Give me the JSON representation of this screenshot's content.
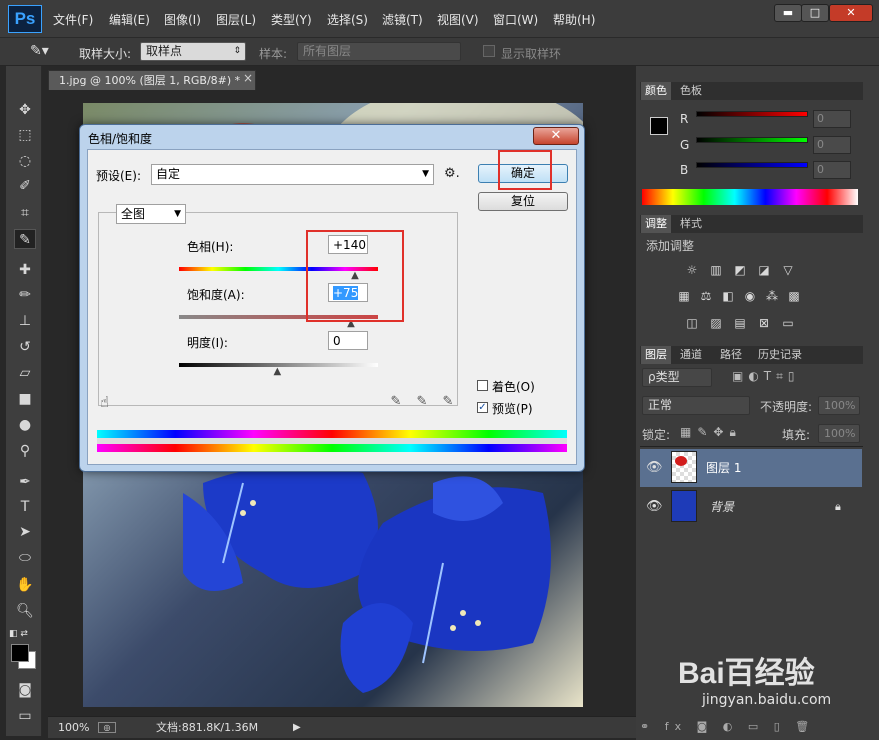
{
  "app": {
    "logo": "Ps"
  },
  "menu": [
    "文件(F)",
    "编辑(E)",
    "图像(I)",
    "图层(L)",
    "类型(Y)",
    "选择(S)",
    "滤镜(T)",
    "视图(V)",
    "窗口(W)",
    "帮助(H)"
  ],
  "window_controls": {
    "minimize": "▬",
    "maximize": "□",
    "close": "✕"
  },
  "options": {
    "sample_size_label": "取样大小:",
    "sample_size_value": "取样点",
    "sample_label": "样本:",
    "sample_value": "所有图层",
    "show_ring": "显示取样环"
  },
  "document": {
    "tab_title": "1.jpg @ 100% (图层 1, RGB/8#) *",
    "tab_close": "×",
    "zoom": "100%",
    "doc_info": "文档:881.8K/1.36M"
  },
  "color_panel": {
    "tabs": [
      "颜色",
      "色板"
    ],
    "channels": [
      {
        "label": "R",
        "value": "0",
        "color": "#ff0000"
      },
      {
        "label": "G",
        "value": "0",
        "color": "#00ff00"
      },
      {
        "label": "B",
        "value": "0",
        "color": "#0000ff"
      }
    ]
  },
  "adjust_panel": {
    "tabs": [
      "调整",
      "样式"
    ],
    "header": "添加调整"
  },
  "layers_panel": {
    "tabs": [
      "图层",
      "通道",
      "路径",
      "历史记录"
    ],
    "filter": "ρ类型",
    "blend_mode": "正常",
    "opacity_label": "不透明度:",
    "opacity_value": "100%",
    "lock_label": "锁定:",
    "fill_label": "填充:",
    "fill_value": "100%",
    "layers": [
      {
        "name": "图层 1",
        "selected": true
      },
      {
        "name": "背景",
        "italic": true,
        "locked": true
      }
    ]
  },
  "dialog": {
    "title": "色相/饱和度",
    "close": "✕",
    "preset_label": "预设(E):",
    "preset_value": "自定",
    "ok": "确定",
    "reset": "复位",
    "channel": "全图",
    "hue_label": "色相(H):",
    "hue_value": "+140",
    "hue_level": 0.89,
    "sat_label": "饱和度(A):",
    "sat_value": "+75",
    "sat_level": 0.87,
    "light_label": "明度(I):",
    "light_value": "0",
    "light_level": 0.5,
    "colorize": "着色(O)",
    "preview": "预览(P)",
    "preview_checked": true,
    "colorize_checked": false
  },
  "watermark": {
    "text": "Bai百经验",
    "url": "jingyan.baidu.com"
  }
}
